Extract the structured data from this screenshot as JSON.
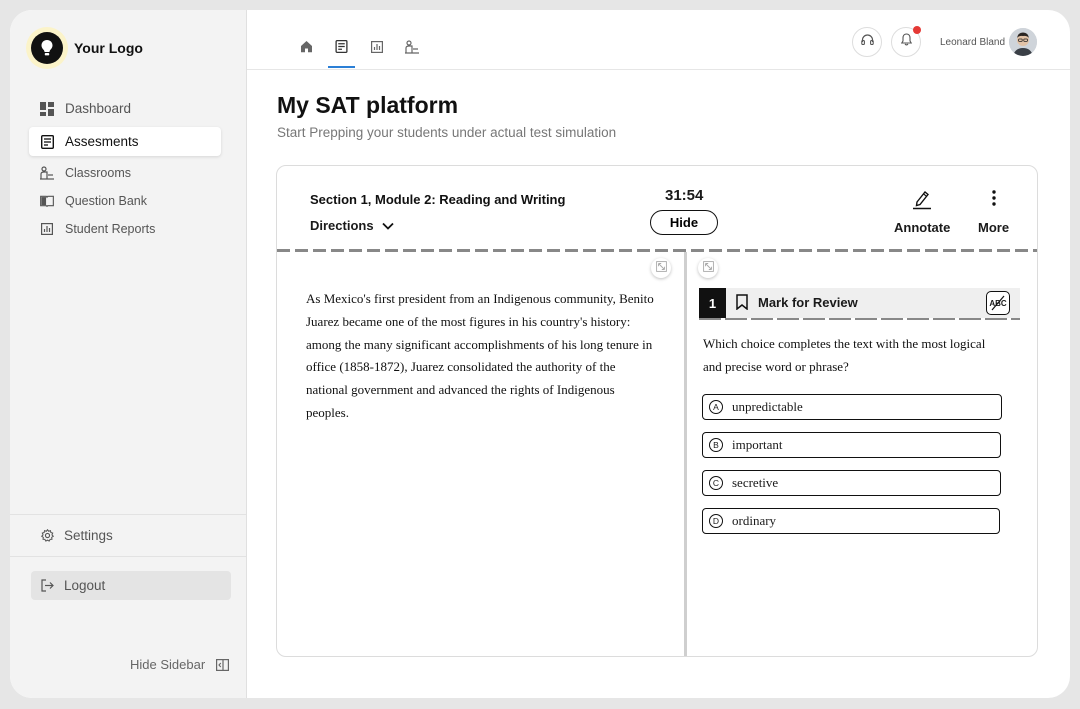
{
  "sidebar": {
    "logo_text": "Your Logo",
    "items": [
      {
        "label": "Dashboard",
        "icon": "dashboard-icon"
      },
      {
        "label": "Assesments",
        "icon": "assessment-icon"
      },
      {
        "label": "Classrooms",
        "icon": "classroom-icon"
      },
      {
        "label": "Question Bank",
        "icon": "book-icon"
      },
      {
        "label": "Student Reports",
        "icon": "chart-icon"
      }
    ],
    "settings_label": "Settings",
    "logout_label": "Logout",
    "hide_sidebar_label": "Hide Sidebar"
  },
  "header": {
    "tabs": [
      {
        "name": "home",
        "icon": "home-icon"
      },
      {
        "name": "assessments",
        "icon": "assessment-icon"
      },
      {
        "name": "reports",
        "icon": "chart-icon"
      },
      {
        "name": "classrooms",
        "icon": "classroom-icon"
      }
    ],
    "active_tab": "assessments",
    "user_name": "Leonard Bland",
    "has_notification": true
  },
  "main": {
    "title": "My SAT platform",
    "subtitle": "Start Prepping your students under actual test simulation"
  },
  "test": {
    "section_title": "Section 1, Module 2: Reading and Writing",
    "directions_label": "Directions",
    "timer": "31:54",
    "hide_label": "Hide",
    "annotate_label": "Annotate",
    "more_label": "More",
    "passage": "As Mexico's first president from an Indigenous community, Benito Juarez became one of the most figures in his country's history: among the many significant accomplishments of his long tenure in office (1858-1872), Juarez consolidated the authority of the national government and advanced the rights of Indigenous peoples.",
    "question_number": "1",
    "mark_review_label": "Mark for Review",
    "abc_label": "ABC",
    "question": "Which choice completes the text with the most logical and precise word or phrase?",
    "choices": [
      {
        "letter": "A",
        "text": "unpredictable"
      },
      {
        "letter": "B",
        "text": "important"
      },
      {
        "letter": "C",
        "text": "secretive"
      },
      {
        "letter": "D",
        "text": "ordinary"
      }
    ]
  },
  "colors": {
    "accent": "#2b7fd6",
    "notification": "#e53935",
    "logo_glow": "#fbf3c9"
  }
}
